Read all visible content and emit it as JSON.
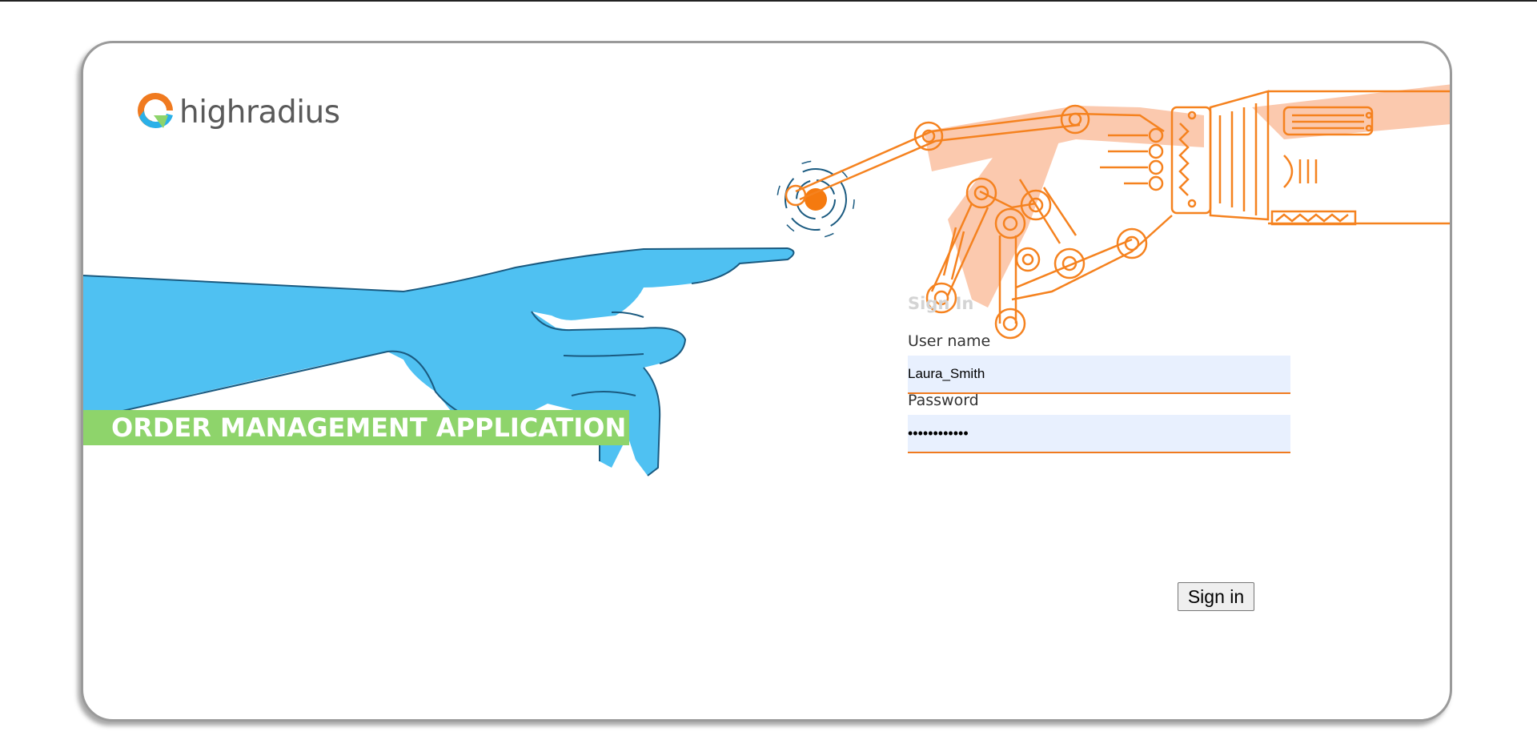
{
  "brand": {
    "logo_text": "highradius",
    "icon": "highradius-logo-icon",
    "colors": {
      "orange": "#f07a1f",
      "blue": "#2ab0e8",
      "green": "#8ed46b",
      "robot": "#f5821f",
      "human": "#4fc1f2"
    }
  },
  "banner": {
    "text": "ORDER MANAGEMENT APPLICATION"
  },
  "signin": {
    "title": "Sign In",
    "username_label": "User name",
    "username_value": "Laura_Smith",
    "password_label": "Password",
    "password_value": "••••••••••••",
    "button_label": "Sign in"
  }
}
